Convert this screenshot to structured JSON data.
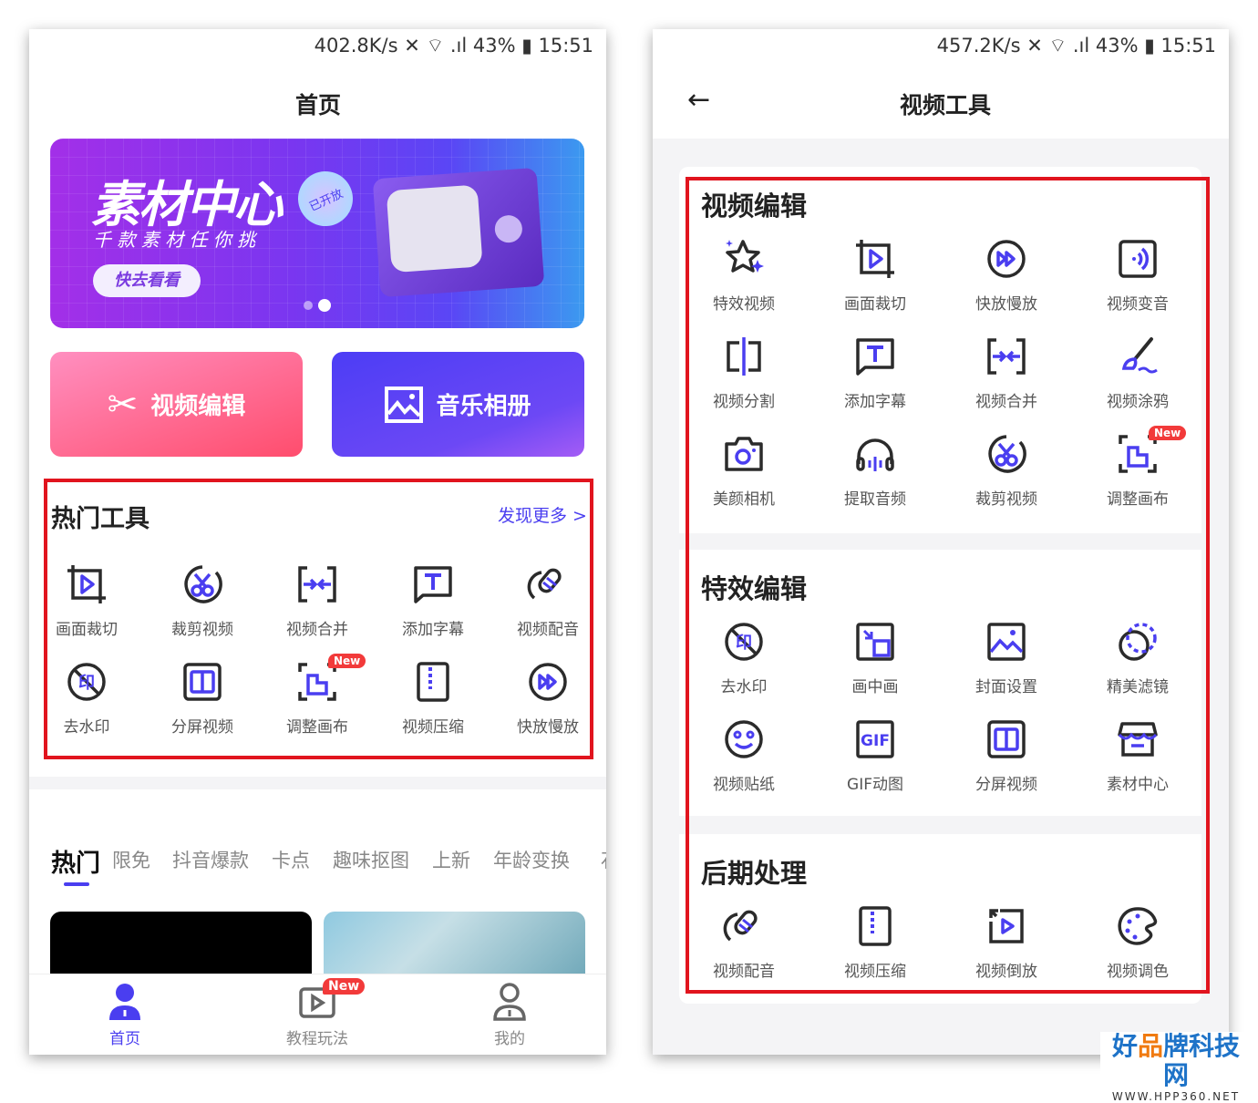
{
  "left": {
    "status": "402.8K/s ✕ ⌔ .ıl 43% ▮ 15:51",
    "title": "首页",
    "banner": {
      "title": "素材中心",
      "badge": "已开放",
      "subtitle": "千 款 素 材 任 你 挑",
      "button": "快去看看",
      "slides": 2,
      "active_slide": 2
    },
    "quick": [
      {
        "label": "视频编辑",
        "icon": "scissors-icon"
      },
      {
        "label": "音乐相册",
        "icon": "image-icon"
      }
    ],
    "hot": {
      "title": "热门工具",
      "more": "发现更多 >",
      "items": [
        {
          "label": "画面裁切",
          "icon": "crop"
        },
        {
          "label": "裁剪视频",
          "icon": "cutcircle"
        },
        {
          "label": "视频合并",
          "icon": "merge"
        },
        {
          "label": "添加字幕",
          "icon": "text"
        },
        {
          "label": "视频配音",
          "icon": "mic"
        },
        {
          "label": "去水印",
          "icon": "watermark"
        },
        {
          "label": "分屏视频",
          "icon": "split-screen"
        },
        {
          "label": "调整画布",
          "icon": "canvas",
          "badge": "New"
        },
        {
          "label": "视频压缩",
          "icon": "compress"
        },
        {
          "label": "快放慢放",
          "icon": "fast"
        }
      ]
    },
    "tabs": [
      "热门",
      "限免",
      "抖音爆款",
      "卡点",
      "趣味抠图",
      "上新",
      "年龄变换",
      "石"
    ],
    "active_tab": 0,
    "nav": [
      {
        "label": "首页",
        "icon": "person-filled-icon",
        "active": true
      },
      {
        "label": "教程玩法",
        "icon": "play-icon",
        "badge": "New"
      },
      {
        "label": "我的",
        "icon": "person-outline-icon"
      }
    ]
  },
  "right": {
    "status": "457.2K/s ✕ ⌔ .ıl 43% ▮ 15:51",
    "title": "视频工具",
    "back": "←",
    "sections": [
      {
        "title": "视频编辑",
        "items": [
          {
            "label": "特效视频",
            "icon": "star"
          },
          {
            "label": "画面裁切",
            "icon": "crop"
          },
          {
            "label": "快放慢放",
            "icon": "fast"
          },
          {
            "label": "视频变音",
            "icon": "voice"
          },
          {
            "label": "视频分割",
            "icon": "split"
          },
          {
            "label": "添加字幕",
            "icon": "text"
          },
          {
            "label": "视频合并",
            "icon": "merge"
          },
          {
            "label": "视频涂鸦",
            "icon": "brush"
          },
          {
            "label": "美颜相机",
            "icon": "camera"
          },
          {
            "label": "提取音频",
            "icon": "headphones"
          },
          {
            "label": "裁剪视频",
            "icon": "cutcircle"
          },
          {
            "label": "调整画布",
            "icon": "canvas",
            "badge": "New"
          }
        ]
      },
      {
        "title": "特效编辑",
        "items": [
          {
            "label": "去水印",
            "icon": "watermark"
          },
          {
            "label": "画中画",
            "icon": "pip"
          },
          {
            "label": "封面设置",
            "icon": "picture"
          },
          {
            "label": "精美滤镜",
            "icon": "filter"
          },
          {
            "label": "视频贴纸",
            "icon": "sticker"
          },
          {
            "label": "GIF动图",
            "icon": "gif"
          },
          {
            "label": "分屏视频",
            "icon": "split-screen"
          },
          {
            "label": "素材中心",
            "icon": "store"
          }
        ]
      },
      {
        "title": "后期处理",
        "items": [
          {
            "label": "视频配音",
            "icon": "mic"
          },
          {
            "label": "视频压缩",
            "icon": "compress"
          },
          {
            "label": "视频倒放",
            "icon": "reverse"
          },
          {
            "label": "视频调色",
            "icon": "palette"
          }
        ]
      }
    ]
  },
  "watermark": {
    "text": "好品牌科技网",
    "url": "WWW.HPP360.NET"
  },
  "colors": {
    "accent": "#4a3ef0",
    "dark": "#2b2b2b",
    "highlight": "#e1141e",
    "badge": "#f23a3a"
  }
}
